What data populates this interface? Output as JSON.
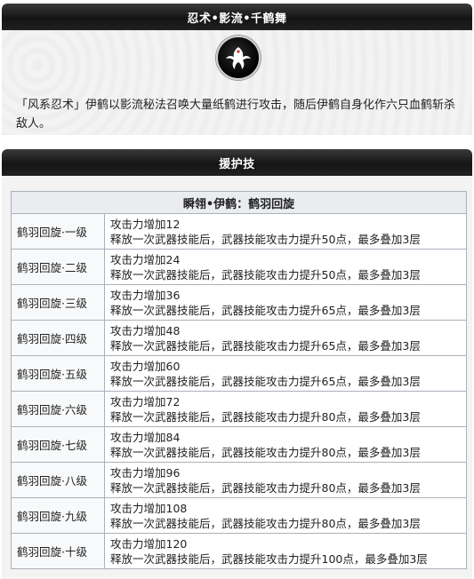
{
  "ninjutsu": {
    "title": "忍术•影流•千鹤舞",
    "description": "「风系忍术」伊鹤以影流秘法召唤大量纸鹤进行攻击，随后伊鹤自身化作六只血鹤斩杀敌人。",
    "emblem_icon": "crane-emblem-icon"
  },
  "support": {
    "title": "援护技",
    "table_title": "瞬翎•伊鹤：鹤羽回旋",
    "rows": [
      {
        "level": "鹤羽回旋·一级",
        "line1": "攻击力增加12",
        "line2": "释放一次武器技能后，武器技能攻击力提升50点，最多叠加3层"
      },
      {
        "level": "鹤羽回旋·二级",
        "line1": "攻击力增加24",
        "line2": "释放一次武器技能后，武器技能攻击力提升50点，最多叠加3层"
      },
      {
        "level": "鹤羽回旋·三级",
        "line1": "攻击力增加36",
        "line2": "释放一次武器技能后，武器技能攻击力提升65点，最多叠加3层"
      },
      {
        "level": "鹤羽回旋·四级",
        "line1": "攻击力增加48",
        "line2": "释放一次武器技能后，武器技能攻击力提升65点，最多叠加3层"
      },
      {
        "level": "鹤羽回旋·五级",
        "line1": "攻击力增加60",
        "line2": "释放一次武器技能后，武器技能攻击力提升65点，最多叠加3层"
      },
      {
        "level": "鹤羽回旋·六级",
        "line1": "攻击力增加72",
        "line2": "释放一次武器技能后，武器技能攻击力提升80点，最多叠加3层"
      },
      {
        "level": "鹤羽回旋·七级",
        "line1": "攻击力增加84",
        "line2": "释放一次武器技能后，武器技能攻击力提升80点，最多叠加3层"
      },
      {
        "level": "鹤羽回旋·八级",
        "line1": "攻击力增加96",
        "line2": "释放一次武器技能后，武器技能攻击力提升80点，最多叠加3层"
      },
      {
        "level": "鹤羽回旋·九级",
        "line1": "攻击力增加108",
        "line2": "释放一次武器技能后，武器技能攻击力提升80点，最多叠加3层"
      },
      {
        "level": "鹤羽回旋·十级",
        "line1": "攻击力增加120",
        "line2": "释放一次武器技能后，武器技能攻击力提升100点，最多叠加3层"
      }
    ]
  }
}
